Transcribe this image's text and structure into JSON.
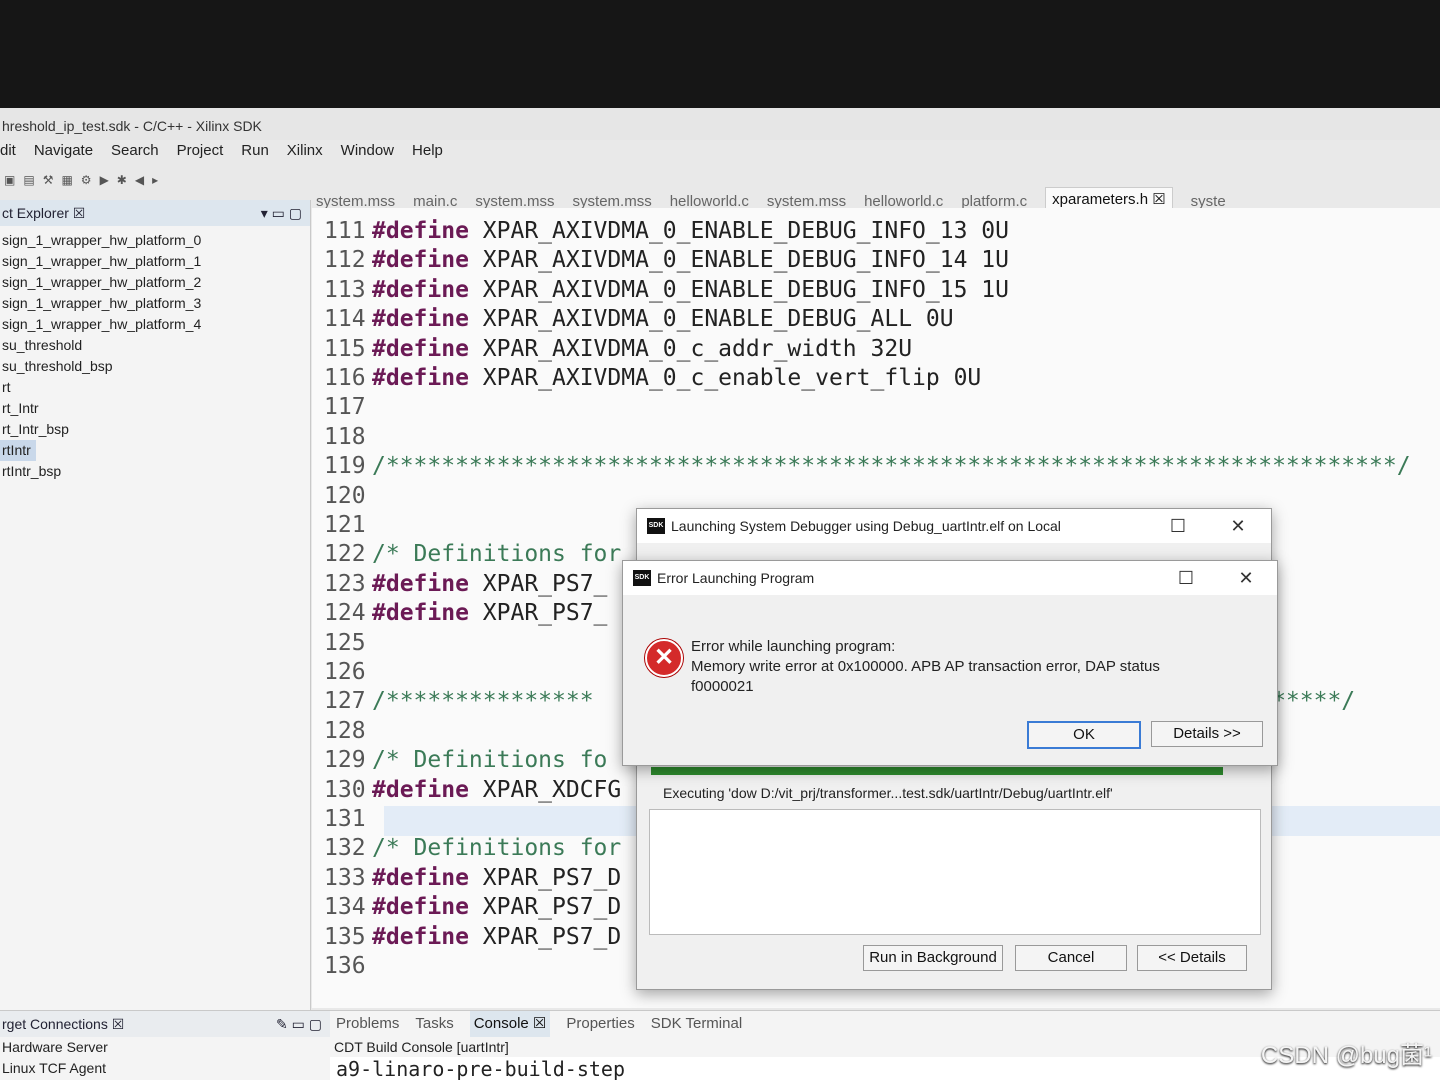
{
  "window": {
    "title": "hreshold_ip_test.sdk - C/C++ - Xilinx SDK"
  },
  "menu": [
    "dit",
    "Navigate",
    "Search",
    "Project",
    "Run",
    "Xilinx",
    "Window",
    "Help"
  ],
  "explorer": {
    "title": "ct Explorer ☒",
    "items": [
      "sign_1_wrapper_hw_platform_0",
      "sign_1_wrapper_hw_platform_1",
      "sign_1_wrapper_hw_platform_2",
      "sign_1_wrapper_hw_platform_3",
      "sign_1_wrapper_hw_platform_4",
      "su_threshold",
      "su_threshold_bsp",
      "rt",
      "rt_Intr",
      "rt_Intr_bsp",
      "rtIntr",
      "rtIntr_bsp"
    ]
  },
  "editor_tabs": [
    "system.mss",
    "main.c",
    "system.mss",
    "system.mss",
    "helloworld.c",
    "system.mss",
    "helloworld.c",
    "platform.c",
    "xparameters.h ☒",
    "syste"
  ],
  "code_lines": [
    {
      "n": "111",
      "kw": "#define",
      "rest": " XPAR_AXIVDMA_0_ENABLE_DEBUG_INFO_13 0U"
    },
    {
      "n": "112",
      "kw": "#define",
      "rest": " XPAR_AXIVDMA_0_ENABLE_DEBUG_INFO_14 1U"
    },
    {
      "n": "113",
      "kw": "#define",
      "rest": " XPAR_AXIVDMA_0_ENABLE_DEBUG_INFO_15 1U"
    },
    {
      "n": "114",
      "kw": "#define",
      "rest": " XPAR_AXIVDMA_0_ENABLE_DEBUG_ALL 0U"
    },
    {
      "n": "115",
      "kw": "#define",
      "rest": " XPAR_AXIVDMA_0_c_addr_width 32U"
    },
    {
      "n": "116",
      "kw": "#define",
      "rest": " XPAR_AXIVDMA_0_c_enable_vert_flip 0U"
    },
    {
      "n": "117",
      "kw": "",
      "rest": ""
    },
    {
      "n": "118",
      "kw": "",
      "rest": ""
    },
    {
      "n": "119",
      "cm": "/*************************************************************************/"
    },
    {
      "n": "120",
      "kw": "",
      "rest": ""
    },
    {
      "n": "121",
      "kw": "",
      "rest": ""
    },
    {
      "n": "122",
      "cm": "/* Definitions for"
    },
    {
      "n": "123",
      "kw": "#define",
      "rest": " XPAR_PS7_"
    },
    {
      "n": "124",
      "kw": "#define",
      "rest": " XPAR_PS7_"
    },
    {
      "n": "125",
      "kw": "",
      "rest": ""
    },
    {
      "n": "126",
      "kw": "",
      "rest": ""
    },
    {
      "n": "127",
      "cm": "/***************                                                ******/"
    },
    {
      "n": "128",
      "kw": "",
      "rest": ""
    },
    {
      "n": "129",
      "cm": "/* Definitions fo"
    },
    {
      "n": "130",
      "kw": "#define",
      "rest": " XPAR_XDCFG"
    },
    {
      "n": "131",
      "kw": "",
      "rest": ""
    },
    {
      "n": "132",
      "cm": "/* Definitions for"
    },
    {
      "n": "133",
      "kw": "#define",
      "rest": " XPAR_PS7_D"
    },
    {
      "n": "134",
      "kw": "#define",
      "rest": " XPAR_PS7_D"
    },
    {
      "n": "135",
      "kw": "#define",
      "rest": " XPAR_PS7_D"
    },
    {
      "n": "136",
      "kw": "",
      "rest": ""
    }
  ],
  "connections": {
    "title": "rget Connections ☒",
    "items": [
      "Hardware Server",
      "Linux TCF Agent"
    ]
  },
  "bottom_tabs": [
    "Problems",
    "Tasks",
    "Console ☒",
    "Properties",
    "SDK Terminal"
  ],
  "console": {
    "title": "CDT Build Console [uartIntr]",
    "line": "a9-linaro-pre-build-step"
  },
  "launch_dialog": {
    "title": "Launching System Debugger using Debug_uartIntr.elf on Local",
    "executing": "Executing 'dow D:/vit_prj/transformer...test.sdk/uartIntr/Debug/uartIntr.elf'",
    "btn_background": "Run in Background",
    "btn_cancel": "Cancel",
    "btn_details": "<< Details",
    "progress_color": "#2e8b2e"
  },
  "error_dialog": {
    "title": "Error Launching Program",
    "line1": "Error while launching program:",
    "line2": "Memory write error at 0x100000. APB AP transaction error, DAP status",
    "line3": "f0000021",
    "btn_ok": "OK",
    "btn_details": "Details >>"
  },
  "icons": {
    "sdk": "SDK",
    "error": "✕"
  },
  "watermark": "CSDN @bug菌¹"
}
